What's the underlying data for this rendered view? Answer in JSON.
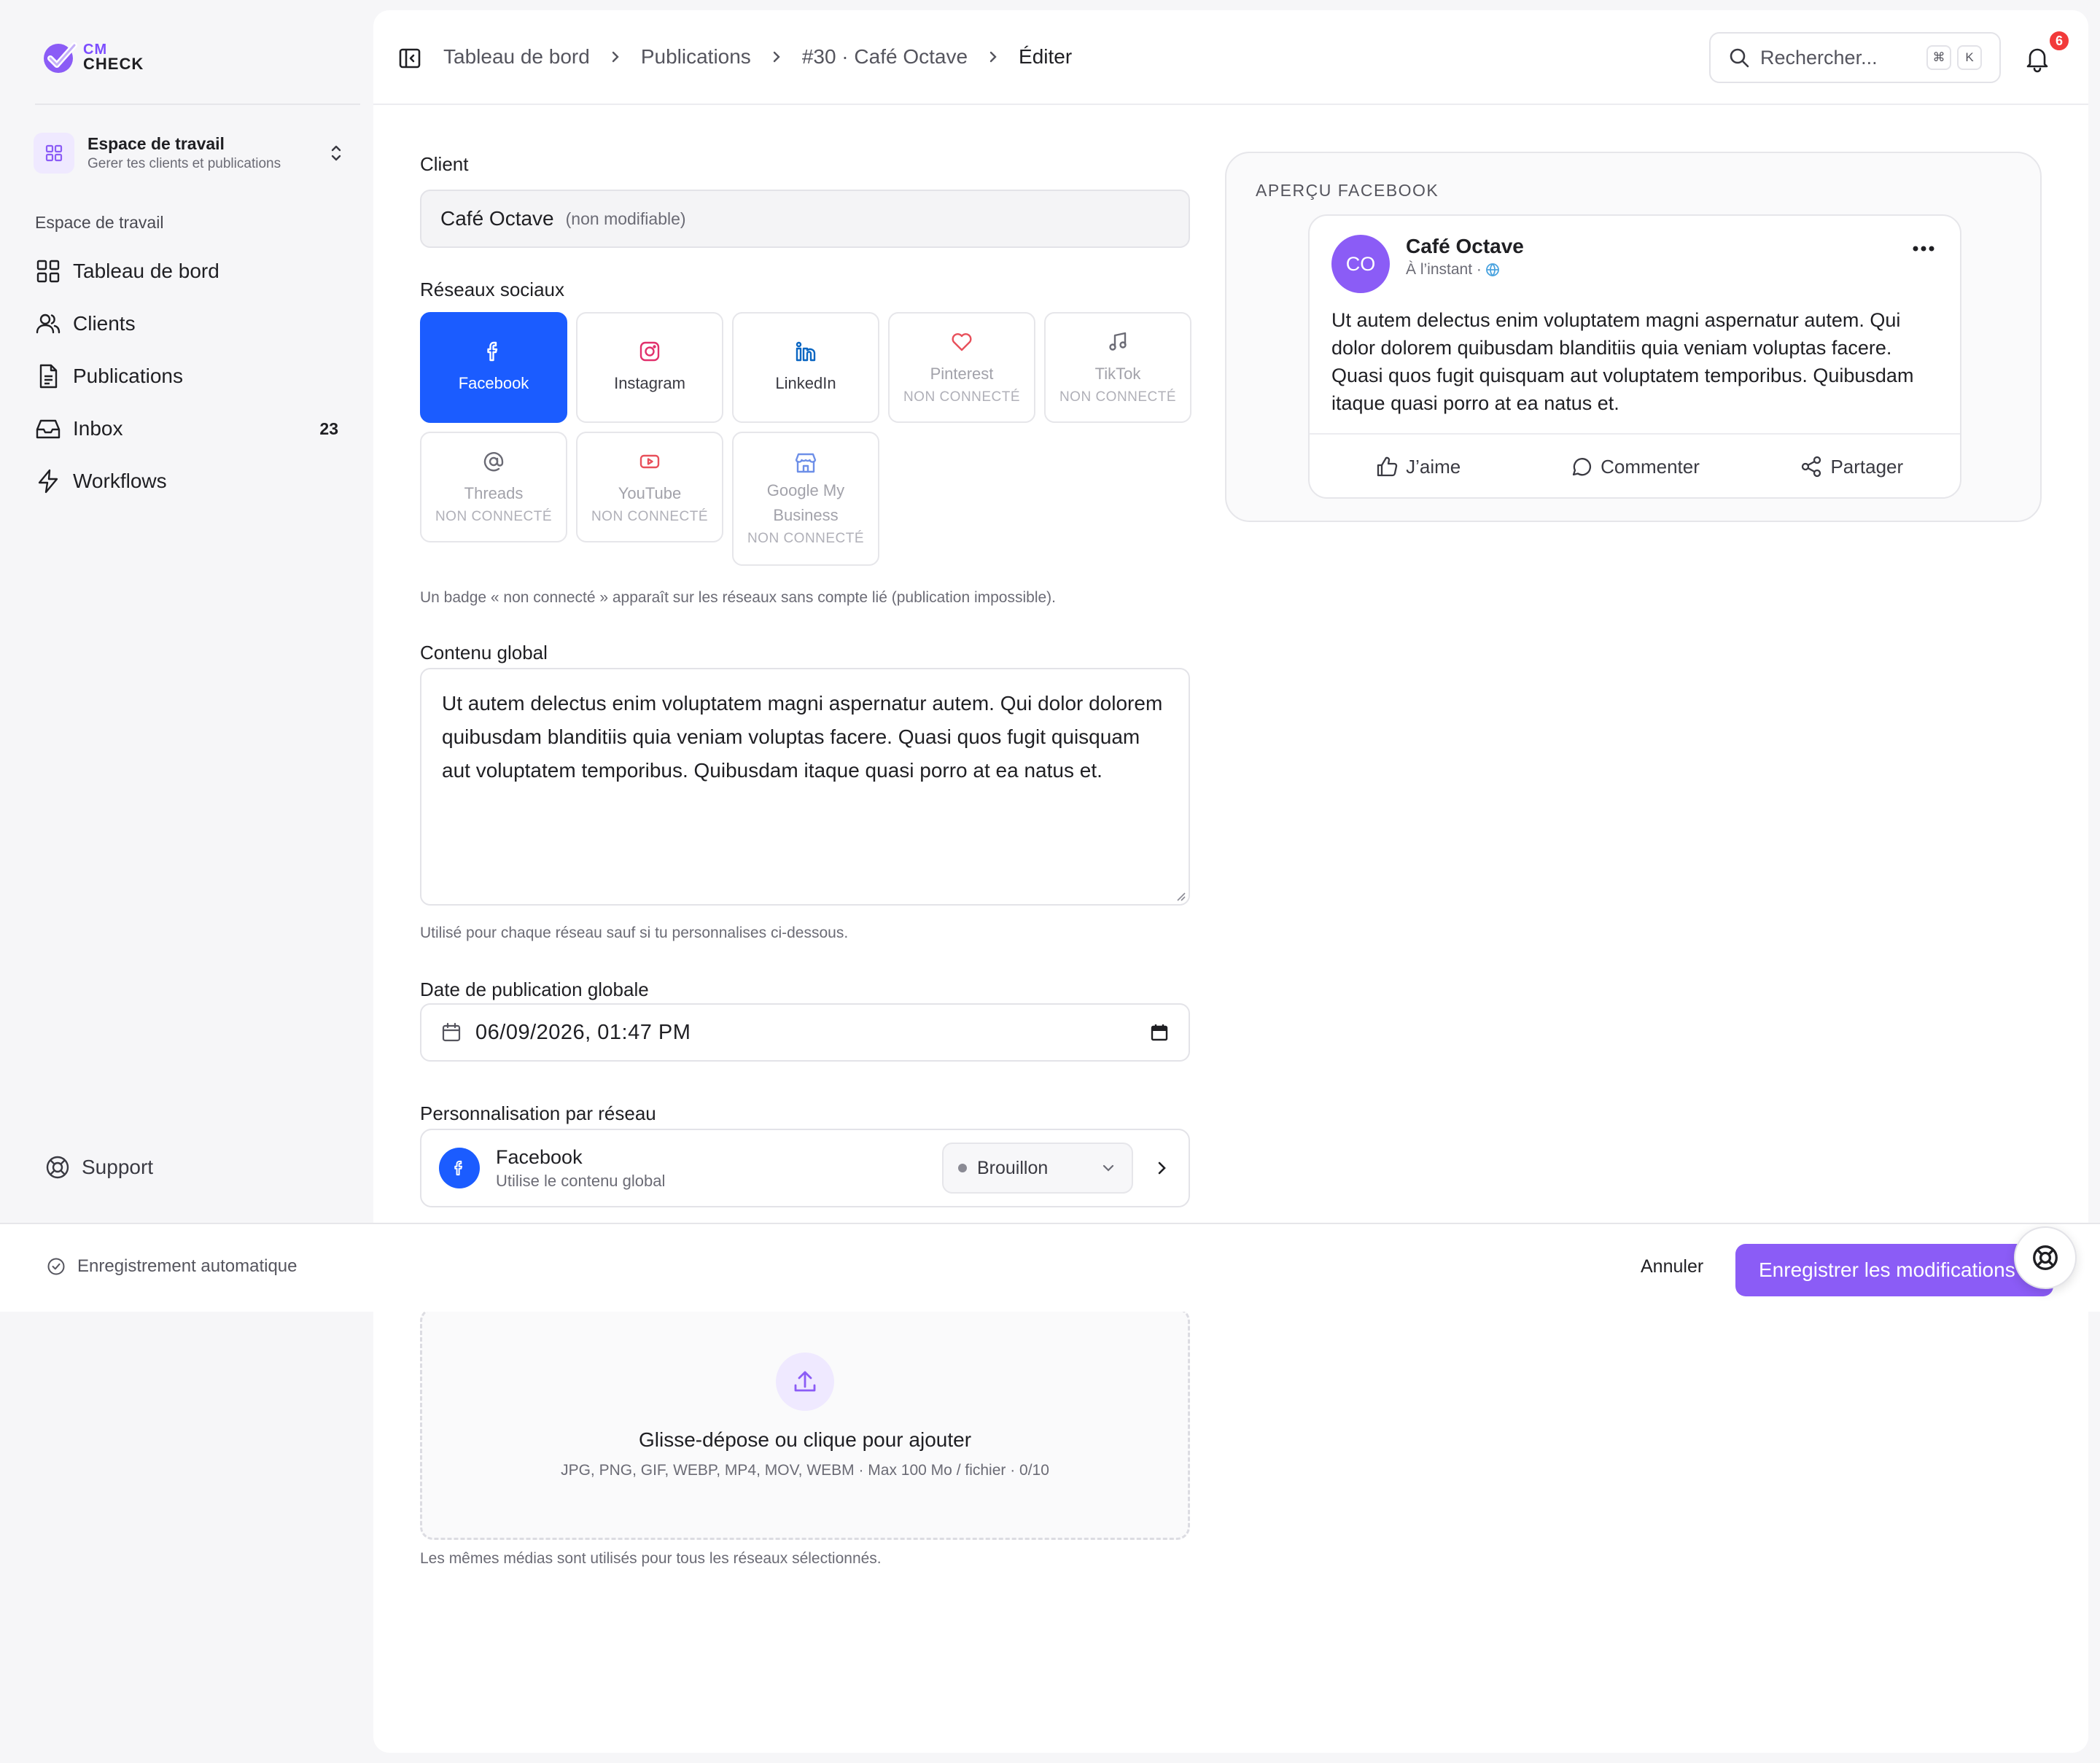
{
  "brand": {
    "line1": "CM",
    "line2": "CHECK",
    "accent": "#8b5cf6",
    "primary_blue": "#1b5cff"
  },
  "sidebar": {
    "workspace": {
      "title": "Espace de travail",
      "subtitle": "Gerer tes clients et publications",
      "icon": "grid-icon"
    },
    "section_label": "Espace de travail",
    "items": [
      {
        "label": "Tableau de bord",
        "icon": "dashboard-icon"
      },
      {
        "label": "Clients",
        "icon": "users-icon"
      },
      {
        "label": "Publications",
        "icon": "document-icon"
      },
      {
        "label": "Inbox",
        "icon": "inbox-icon",
        "count": "23"
      },
      {
        "label": "Workflows",
        "icon": "lightning-icon"
      }
    ],
    "support": "Support"
  },
  "header": {
    "breadcrumb": [
      "Tableau de bord",
      "Publications",
      "#30 · Café Octave",
      "Éditer"
    ],
    "search_placeholder": "Rechercher...",
    "shortcut": [
      "⌘",
      "K"
    ],
    "notifications": "6"
  },
  "form": {
    "client_label": "Client",
    "client_value": "Café Octave",
    "client_note": "(non modifiable)",
    "networks_label": "Réseaux sociaux",
    "networks": [
      {
        "name": "Facebook",
        "badge": "",
        "active": true
      },
      {
        "name": "Instagram",
        "badge": "",
        "active": false
      },
      {
        "name": "LinkedIn",
        "badge": "",
        "active": false
      },
      {
        "name": "Pinterest",
        "badge": "NON CONNECTÉ",
        "active": false
      },
      {
        "name": "TikTok",
        "badge": "NON CONNECTÉ",
        "active": false
      },
      {
        "name": "Threads",
        "badge": "NON CONNECTÉ",
        "active": false
      },
      {
        "name": "YouTube",
        "badge": "NON CONNECTÉ",
        "active": false
      },
      {
        "name": "Google My Business",
        "badge": "NON CONNECTÉ",
        "active": false
      }
    ],
    "networks_help": "Un badge « non connecté » apparaît sur les réseaux sans compte lié (publication impossible).",
    "content_label": "Contenu global",
    "content_value": "Ut autem delectus enim voluptatem magni aspernatur autem. Qui dolor dolorem quibusdam blanditiis quia veniam voluptas facere. Quasi quos fugit quisquam aut voluptatem temporibus. Quibusdam itaque quasi porro at ea natus et.",
    "content_help": "Utilisé pour chaque réseau sauf si tu personnalises ci-dessous.",
    "date_label": "Date de publication globale",
    "date_value": "06/09/2026, 01:47 PM",
    "perso_label": "Personnalisation par réseau",
    "perso_item": {
      "name": "Facebook",
      "sub": "Utilise le contenu global",
      "status": "Brouillon"
    },
    "upload_title": "Glisse-dépose ou clique pour ajouter",
    "upload_sub": "JPG, PNG, GIF, WEBP, MP4, MOV, WEBM · Max 100 Mo / fichier · 0/10",
    "upload_help": "Les mêmes médias sont utilisés pour tous les réseaux sélectionnés."
  },
  "preview": {
    "label": "APERÇU FACEBOOK",
    "avatar": "CO",
    "name": "Café Octave",
    "time": "À l’instant ·",
    "text": "Ut autem delectus enim voluptatem magni aspernatur autem. Qui dolor dolorem quibusdam blanditiis quia veniam voluptas facere. Quasi quos fugit quisquam aut voluptatem temporibus. Quibusdam itaque quasi porro at ea natus et.",
    "actions": [
      "J’aime",
      "Commenter",
      "Partager"
    ]
  },
  "footer": {
    "autosave": "Enregistrement automatique",
    "cancel": "Annuler",
    "save": "Enregistrer les modifications"
  }
}
